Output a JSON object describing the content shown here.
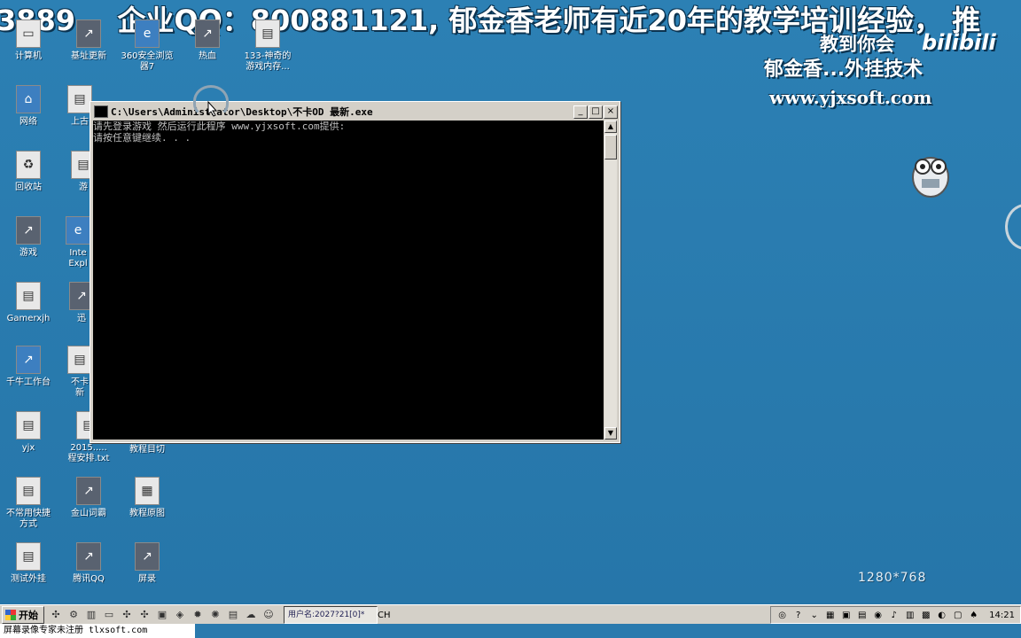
{
  "banner": {
    "left_text": "3889,",
    "qq_text": "企业QQ：800881121,",
    "rest_text": "郁金香老师有近20年的教学培训经验，",
    "tail_text": "推"
  },
  "branding": {
    "line1": "教到你会",
    "logo": "bilibili",
    "line2": "郁金香...外挂技术",
    "line3": "www.yjxsoft.com",
    "resolution": "1280*768"
  },
  "desktop_icons": [
    {
      "label": "计算机"
    },
    {
      "label": "基址更新"
    },
    {
      "label": "360安全浏览\n器7"
    },
    {
      "label": "热血"
    },
    {
      "label": "133-神奇的\n游戏内存..."
    },
    {
      "label": "网络"
    },
    {
      "label": "上古"
    },
    {
      "label": "回收站"
    },
    {
      "label": "游"
    },
    {
      "label": "游戏"
    },
    {
      "label": "Inte\nExpl"
    },
    {
      "label": "Gamerxjh"
    },
    {
      "label": "迅"
    },
    {
      "label": "千牛工作台"
    },
    {
      "label": "不卡\n新"
    },
    {
      "label": "yjx"
    },
    {
      "label": "2015.....\n程安排.txt"
    },
    {
      "label": "教程目切"
    },
    {
      "label": "不常用快捷\n方式"
    },
    {
      "label": "金山词霸"
    },
    {
      "label": "教程原图"
    },
    {
      "label": "测试外挂"
    },
    {
      "label": "腾讯QQ"
    },
    {
      "label": "屏录"
    }
  ],
  "console": {
    "title": "C:\\Users\\Administrator\\Desktop\\不卡OD 最新.exe",
    "lines": [
      "请先登录游戏 然后运行此程序 www.yjxsoft.com提供:",
      "请按任意键继续. . ."
    ],
    "buttons": {
      "minimize": "_",
      "maximize": "□",
      "close": "×"
    }
  },
  "taskbar": {
    "start_label": "开始",
    "task_label": "用户名:2027?21[0]*",
    "lang": "CH",
    "clock": "14:21"
  },
  "watermark": "屏幕录像专家未注册 tlxsoft.com"
}
